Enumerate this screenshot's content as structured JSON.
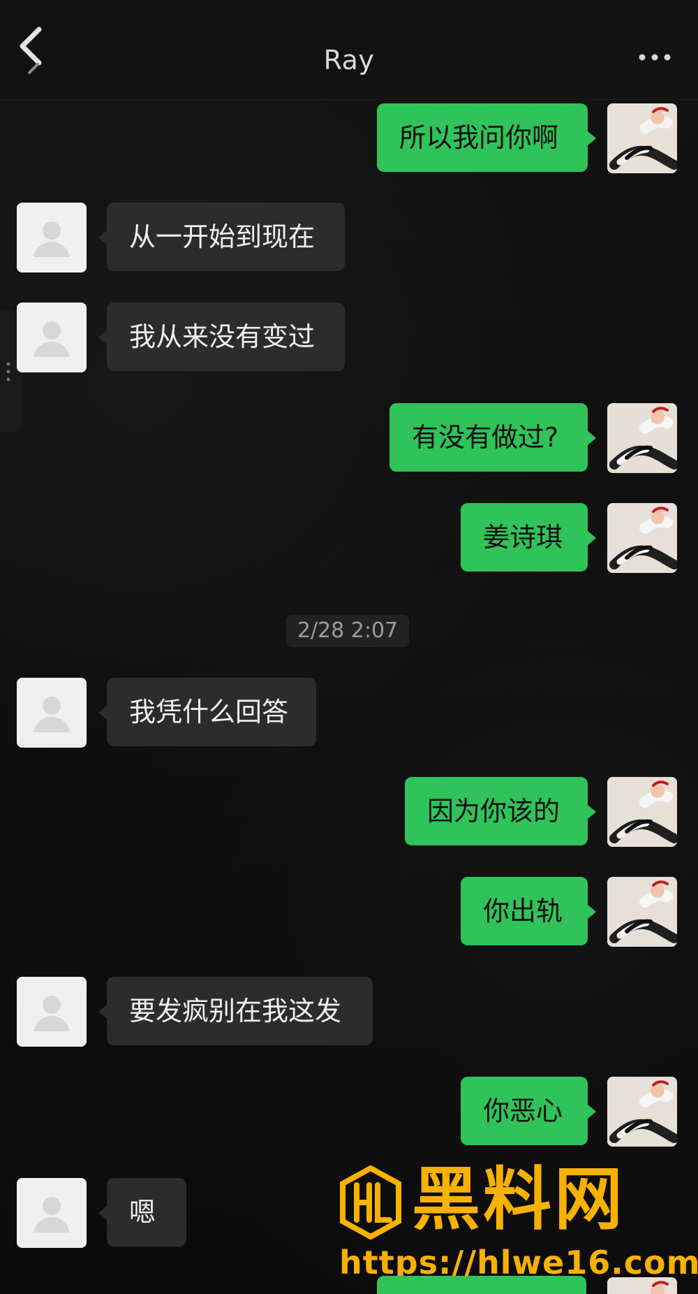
{
  "header": {
    "title": "Ray",
    "back_icon": "chevron-left-icon",
    "more_icon": "more-icon"
  },
  "messages": [
    {
      "side": "right",
      "text": "所以我问你啊"
    },
    {
      "side": "left",
      "text": "从一开始到现在"
    },
    {
      "side": "left",
      "text": "我从来没有变过"
    },
    {
      "side": "right",
      "text": "有没有做过?"
    },
    {
      "side": "right",
      "text": "姜诗琪"
    },
    {
      "side": "left",
      "text": "我凭什么回答"
    },
    {
      "side": "right",
      "text": "因为你该的"
    },
    {
      "side": "right",
      "text": "你出轨"
    },
    {
      "side": "left",
      "text": "要发疯别在我这发"
    },
    {
      "side": "right",
      "text": "你恶心"
    },
    {
      "side": "left",
      "text": "嗯"
    }
  ],
  "timestamp": "2/28 2:07",
  "watermark": {
    "brand": "黑料网",
    "url": "https://hlwe16.com"
  },
  "theme": {
    "background": "#0f0f0f",
    "left_bubble": "#2c2c2c",
    "right_bubble": "#2fc35a",
    "watermark": "#f7b100"
  }
}
